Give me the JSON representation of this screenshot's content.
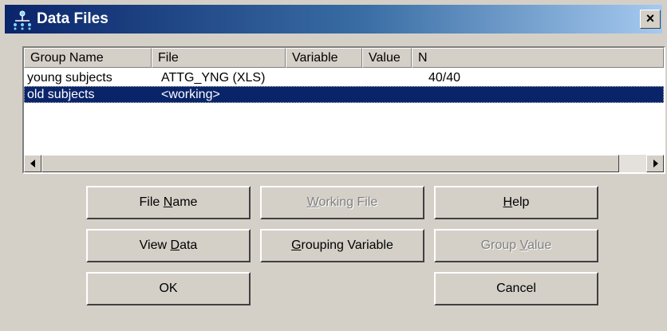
{
  "window": {
    "title": "Data Files",
    "close_label": "×"
  },
  "table": {
    "columns": [
      "Group Name",
      "File",
      "Variable",
      "Value",
      "N"
    ],
    "rows": [
      {
        "group": "young subjects",
        "file": "ATTG_YNG (XLS)",
        "variable": "",
        "value": "",
        "n": "40/40"
      },
      {
        "group": "old subjects",
        "file": "<working>",
        "variable": "",
        "value": "",
        "n": ""
      }
    ]
  },
  "buttons": {
    "file_name": {
      "pre": "File ",
      "key": "N",
      "post": "ame"
    },
    "working_file": {
      "pre": "",
      "key": "W",
      "post": "orking File"
    },
    "help": {
      "pre": "",
      "key": "H",
      "post": "elp"
    },
    "view_data": {
      "pre": "View ",
      "key": "D",
      "post": "ata"
    },
    "grouping_variable": {
      "pre": "",
      "key": "G",
      "post": "rouping Variable"
    },
    "group_value": {
      "pre": "Group ",
      "key": "V",
      "post": "alue"
    },
    "ok": "OK",
    "cancel": "Cancel"
  }
}
